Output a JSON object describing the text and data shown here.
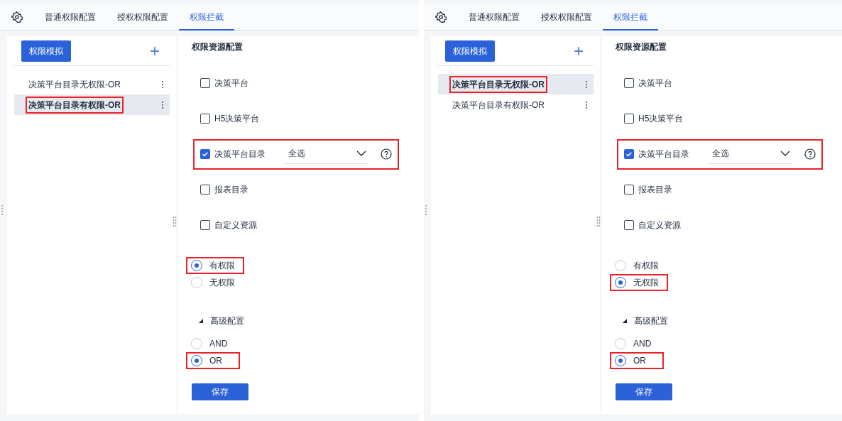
{
  "panels": [
    {
      "tabs": [
        {
          "label": "普通权限配置",
          "selected": false
        },
        {
          "label": "授权权限配置",
          "selected": false
        },
        {
          "label": "权限拦截",
          "selected": true
        }
      ],
      "sidebar": {
        "button": "权限模拟",
        "items": [
          {
            "label": "决策平台目录无权限-OR",
            "selected": false,
            "highlighted": false
          },
          {
            "label": "决策平台目录有权限-OR",
            "selected": true,
            "highlighted": true
          }
        ]
      },
      "section_title": "权限资源配置",
      "resources": [
        {
          "label": "决策平台",
          "checked": false,
          "highlighted": false
        },
        {
          "label": "H5决策平台",
          "checked": false,
          "highlighted": false
        },
        {
          "label": "决策平台目录",
          "checked": true,
          "highlighted": true,
          "select": {
            "value": "全选"
          }
        },
        {
          "label": "报表目录",
          "checked": false,
          "highlighted": false
        },
        {
          "label": "自定义资源",
          "checked": false,
          "highlighted": false
        }
      ],
      "permission_options": [
        {
          "label": "有权限",
          "selected": true,
          "highlighted": true
        },
        {
          "label": "无权限",
          "selected": false,
          "highlighted": false
        }
      ],
      "advanced": {
        "label": "高级配置",
        "expanded": true
      },
      "logic_options": [
        {
          "label": "AND",
          "selected": false,
          "highlighted": false
        },
        {
          "label": "OR",
          "selected": true,
          "highlighted": true
        }
      ],
      "save_button": "保存"
    },
    {
      "tabs": [
        {
          "label": "普通权限配置",
          "selected": false
        },
        {
          "label": "授权权限配置",
          "selected": false
        },
        {
          "label": "权限拦截",
          "selected": true
        }
      ],
      "sidebar": {
        "button": "权限模拟",
        "items": [
          {
            "label": "决策平台目录无权限-OR",
            "selected": true,
            "highlighted": true
          },
          {
            "label": "决策平台目录有权限-OR",
            "selected": false,
            "highlighted": false
          }
        ]
      },
      "section_title": "权限资源配置",
      "resources": [
        {
          "label": "决策平台",
          "checked": false,
          "highlighted": false
        },
        {
          "label": "H5决策平台",
          "checked": false,
          "highlighted": false
        },
        {
          "label": "决策平台目录",
          "checked": true,
          "highlighted": true,
          "select": {
            "value": "全选"
          }
        },
        {
          "label": "报表目录",
          "checked": false,
          "highlighted": false
        },
        {
          "label": "自定义资源",
          "checked": false,
          "highlighted": false
        }
      ],
      "permission_options": [
        {
          "label": "有权限",
          "selected": false,
          "highlighted": false
        },
        {
          "label": "无权限",
          "selected": true,
          "highlighted": true
        }
      ],
      "advanced": {
        "label": "高级配置",
        "expanded": true
      },
      "logic_options": [
        {
          "label": "AND",
          "selected": false,
          "highlighted": false
        },
        {
          "label": "OR",
          "selected": true,
          "highlighted": true
        }
      ],
      "save_button": "保存"
    }
  ]
}
